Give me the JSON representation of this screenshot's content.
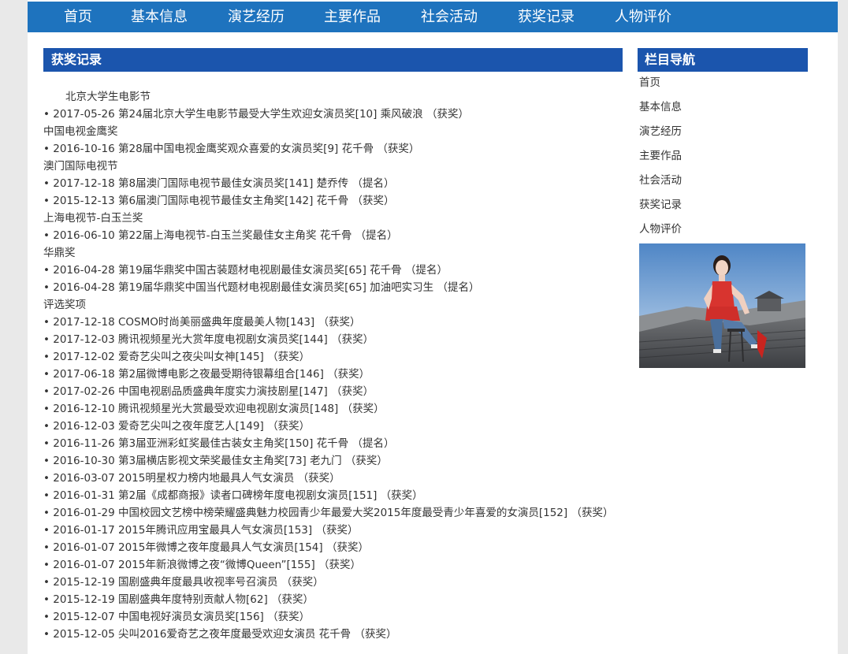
{
  "nav": {
    "items": [
      "首页",
      "基本信息",
      "演艺经历",
      "主要作品",
      "社会活动",
      "获奖记录",
      "人物评价"
    ]
  },
  "main": {
    "title": "获奖记录",
    "lines": [
      {
        "type": "cat",
        "indent": true,
        "text": "北京大学生电影节"
      },
      {
        "type": "item",
        "text": "• 2017-05-26 第24届北京大学生电影节最受大学生欢迎女演员奖[10] 乘风破浪 （获奖）"
      },
      {
        "type": "cat",
        "text": "中国电视金鹰奖"
      },
      {
        "type": "item",
        "text": "• 2016-10-16 第28届中国电视金鹰奖观众喜爱的女演员奖[9] 花千骨 （获奖）"
      },
      {
        "type": "cat",
        "text": "澳门国际电视节"
      },
      {
        "type": "item",
        "text": "• 2017-12-18 第8届澳门国际电视节最佳女演员奖[141] 楚乔传 （提名）"
      },
      {
        "type": "item",
        "text": "• 2015-12-13 第6届澳门国际电视节最佳女主角奖[142] 花千骨 （获奖）"
      },
      {
        "type": "cat",
        "text": "上海电视节-白玉兰奖"
      },
      {
        "type": "item",
        "text": "• 2016-06-10 第22届上海电视节-白玉兰奖最佳女主角奖 花千骨 （提名）"
      },
      {
        "type": "cat",
        "text": "华鼎奖"
      },
      {
        "type": "item",
        "text": "• 2016-04-28 第19届华鼎奖中国古装题材电视剧最佳女演员奖[65] 花千骨 （提名）"
      },
      {
        "type": "item",
        "text": "• 2016-04-28 第19届华鼎奖中国当代题材电视剧最佳女演员奖[65] 加油吧实习生 （提名）"
      },
      {
        "type": "cat",
        "text": "评选奖项"
      },
      {
        "type": "item",
        "text": "• 2017-12-18 COSMO时尚美丽盛典年度最美人物[143] （获奖）"
      },
      {
        "type": "item",
        "text": "• 2017-12-03 腾讯视频星光大赏年度电视剧女演员奖[144] （获奖）"
      },
      {
        "type": "item",
        "text": "• 2017-12-02 爱奇艺尖叫之夜尖叫女神[145] （获奖）"
      },
      {
        "type": "item",
        "text": "• 2017-06-18 第2届微博电影之夜最受期待银幕组合[146] （获奖）"
      },
      {
        "type": "item",
        "text": "• 2017-02-26 中国电视剧品质盛典年度实力演技剧星[147] （获奖）"
      },
      {
        "type": "item",
        "text": "• 2016-12-10 腾讯视频星光大赏最受欢迎电视剧女演员[148] （获奖）"
      },
      {
        "type": "item",
        "text": "• 2016-12-03 爱奇艺尖叫之夜年度艺人[149] （获奖）"
      },
      {
        "type": "item",
        "text": "• 2016-11-26 第3届亚洲彩虹奖最佳古装女主角奖[150] 花千骨 （提名）"
      },
      {
        "type": "item",
        "text": "• 2016-10-30 第3届横店影视文荣奖最佳女主角奖[73] 老九门 （获奖）"
      },
      {
        "type": "item",
        "text": "• 2016-03-07 2015明星权力榜内地最具人气女演员 （获奖）"
      },
      {
        "type": "item",
        "text": "• 2016-01-31 第2届《成都商报》读者口碑榜年度电视剧女演员[151] （获奖）"
      },
      {
        "type": "item",
        "text": "• 2016-01-29 中国校园文艺榜中榜荣耀盛典魅力校园青少年最爱大奖2015年度最受青少年喜爱的女演员[152] （获奖）"
      },
      {
        "type": "item",
        "text": "• 2016-01-17 2015年腾讯应用宝最具人气女演员[153] （获奖）"
      },
      {
        "type": "item",
        "text": "• 2016-01-07 2015年微博之夜年度最具人气女演员[154] （获奖）"
      },
      {
        "type": "item",
        "text": "• 2016-01-07 2015年新浪微博之夜“微博Queen”[155] （获奖）"
      },
      {
        "type": "item",
        "text": "• 2015-12-19 国剧盛典年度最具收视率号召演员 （获奖）"
      },
      {
        "type": "item",
        "text": "• 2015-12-19 国剧盛典年度特别贡献人物[62] （获奖）"
      },
      {
        "type": "item",
        "text": "• 2015-12-07 中国电视好演员女演员奖[156] （获奖）"
      },
      {
        "type": "item",
        "text": "• 2015-12-05 尖叫2016爱奇艺之夜年度最受欢迎女演员 花千骨 （获奖）"
      }
    ]
  },
  "sidebar": {
    "title": "栏目导航",
    "items": [
      "首页",
      "基本信息",
      "演艺经历",
      "主要作品",
      "社会活动",
      "获奖记录",
      "人物评价"
    ]
  },
  "colors": {
    "nav_bg": "#1e73be",
    "title_bar": "#1b55ad"
  }
}
